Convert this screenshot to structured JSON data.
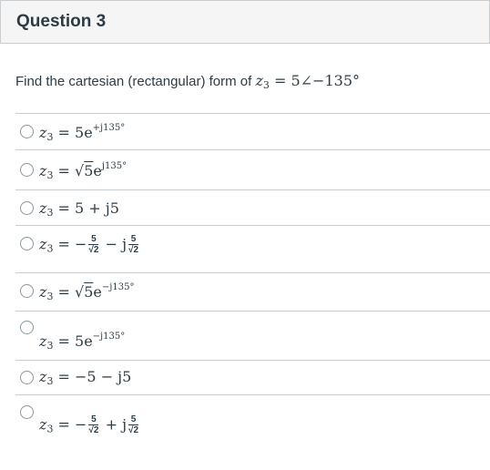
{
  "question": {
    "title": "Question 3",
    "prompt_text": "Find the cartesian (rectangular) form of ",
    "prompt_var": "z",
    "prompt_sub": "3",
    "prompt_expr": " = 5∠−135°"
  },
  "options": [
    {
      "var": "z",
      "sub": "3",
      "eq": " = ",
      "base": "5e",
      "sup": "+j135°"
    },
    {
      "var": "z",
      "sub": "3",
      "eq": " = ",
      "root": "√",
      "rootarg": "5",
      "base": "e",
      "sup": "j135°"
    },
    {
      "var": "z",
      "sub": "3",
      "eq": " = ",
      "base": "5 + j5"
    },
    {
      "var": "z",
      "sub": "3",
      "eq": " = −",
      "num1": "5",
      "den1": "√2",
      "mid": " − j",
      "num2": "5",
      "den2": "√2"
    },
    {
      "var": "z",
      "sub": "3",
      "eq": " = ",
      "root": "√",
      "rootarg": "5",
      "base": "e",
      "sup": "−j135°"
    },
    {
      "var": "z",
      "sub": "3",
      "eq": " = ",
      "base": "5e",
      "sup": "−j135°"
    },
    {
      "var": "z",
      "sub": "3",
      "eq": " = ",
      "base": "−5 − j5"
    },
    {
      "var": "z",
      "sub": "3",
      "eq": " = −",
      "num1": "5",
      "den1": "√2",
      "mid": " + j",
      "num2": "5",
      "den2": "√2"
    }
  ]
}
